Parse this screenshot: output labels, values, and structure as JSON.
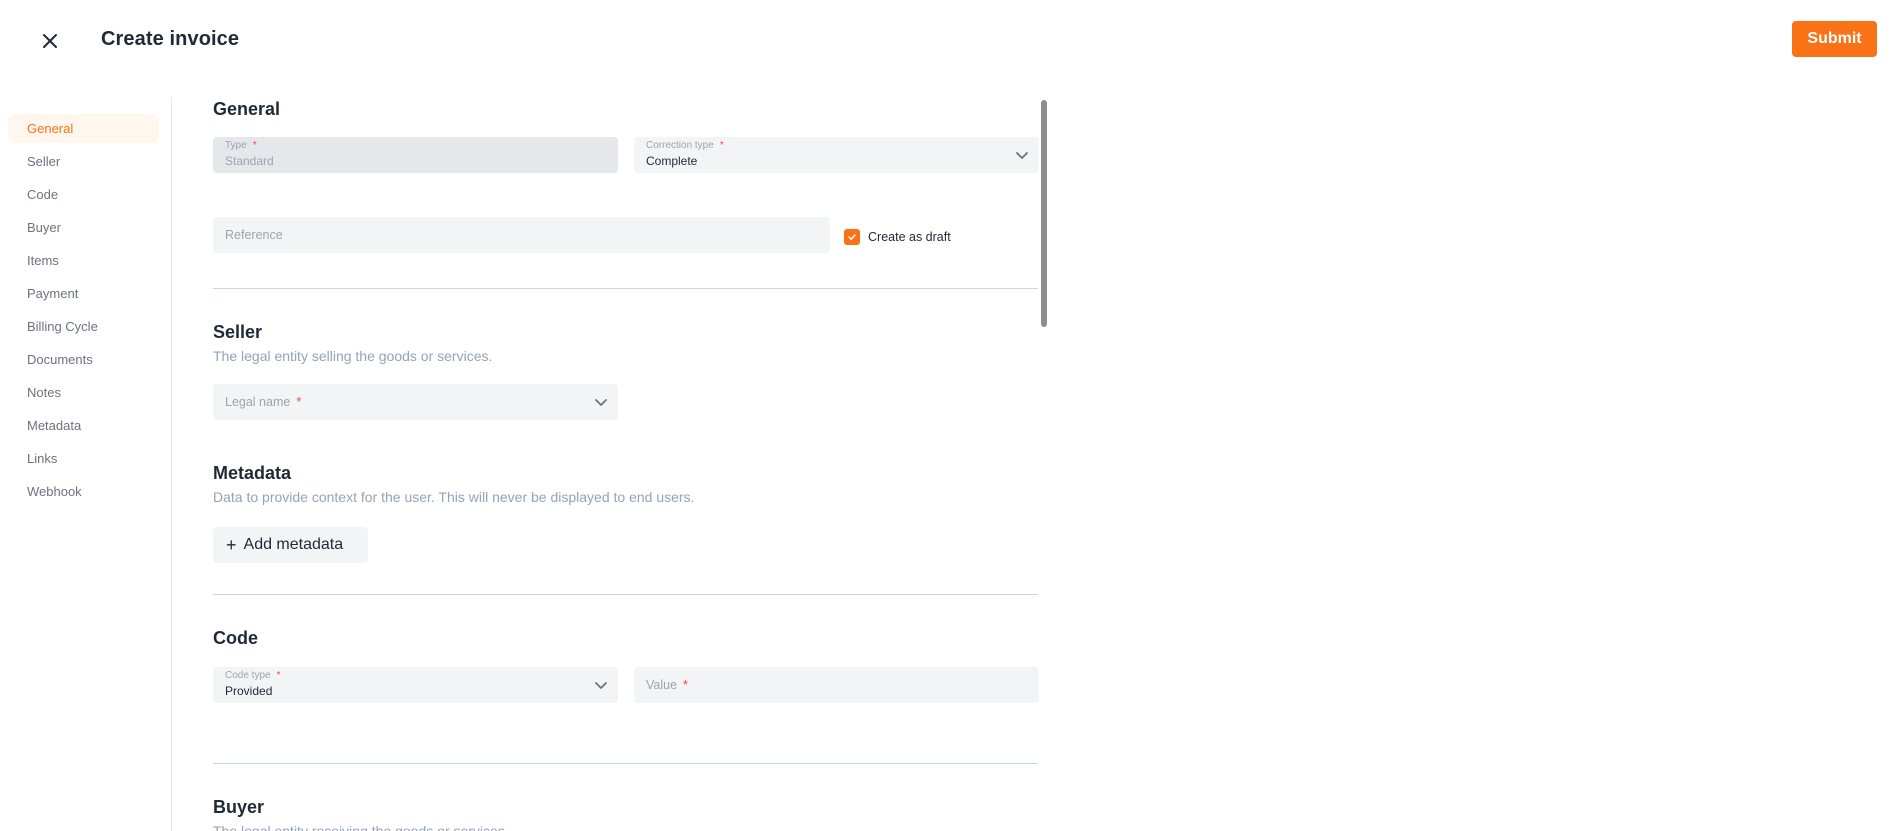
{
  "header": {
    "title": "Create invoice",
    "close_icon": "close-icon",
    "submit_label": "Submit",
    "accent_color": "#f97316"
  },
  "sidebar": {
    "items": [
      {
        "label": "General",
        "active": true
      },
      {
        "label": "Seller"
      },
      {
        "label": "Code"
      },
      {
        "label": "Buyer"
      },
      {
        "label": "Items"
      },
      {
        "label": "Payment"
      },
      {
        "label": "Billing Cycle"
      },
      {
        "label": "Documents"
      },
      {
        "label": "Notes"
      },
      {
        "label": "Metadata"
      },
      {
        "label": "Links"
      },
      {
        "label": "Webhook"
      }
    ]
  },
  "general": {
    "title": "General",
    "type": {
      "label": "Type",
      "value": "Standard",
      "required": "*"
    },
    "correction_type": {
      "label": "Correction type",
      "value": "Complete",
      "required": "*"
    },
    "reference": {
      "placeholder": "Reference"
    },
    "draft": {
      "label": "Create as draft",
      "checked": true
    }
  },
  "seller": {
    "title": "Seller",
    "description": "The legal entity selling the goods or services.",
    "legal_name": {
      "placeholder": "Legal name",
      "required": "*"
    }
  },
  "metadata": {
    "title": "Metadata",
    "description": "Data to provide context for the user. This will never be displayed to end users.",
    "add_label": "Add metadata",
    "add_icon": "+"
  },
  "code": {
    "title": "Code",
    "code_type": {
      "label": "Code type",
      "value": "Provided",
      "required": "*"
    },
    "value": {
      "placeholder": "Value",
      "required": "*"
    }
  },
  "buyer": {
    "title": "Buyer",
    "description": "The legal entity receiving the goods or services."
  }
}
